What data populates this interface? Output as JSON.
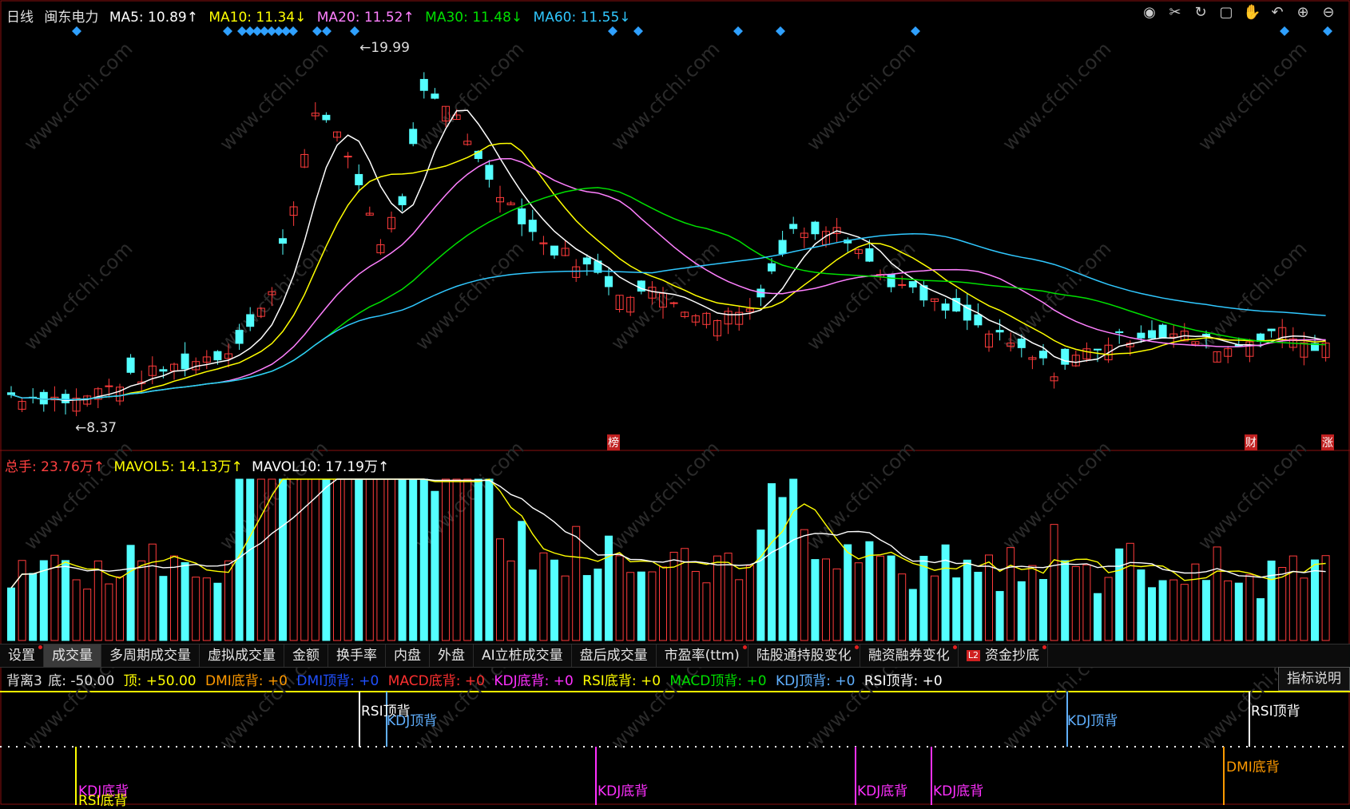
{
  "header": {
    "period": "日线",
    "stock_name": "闽东电力",
    "ma5": "MA5: 10.89↑",
    "ma10": "MA10: 11.34↓",
    "ma20": "MA20: 11.52↑",
    "ma30": "MA30: 11.48↓",
    "ma60": "MA60: 11.55↓"
  },
  "toolbar_icons": [
    "eye-icon",
    "scissors-icon",
    "refresh-icon",
    "lock-icon",
    "hand-icon",
    "undo-icon",
    "zoom-in-icon",
    "zoom-out-icon"
  ],
  "price_labels": {
    "high": "19.99",
    "low": "8.37"
  },
  "event_markers": [
    "榜",
    "财",
    "涨"
  ],
  "volume_header": {
    "total": "总手: 23.76万↑",
    "mavol5": "MAVOL5: 14.13万↑",
    "mavol10": "MAVOL10: 17.19万↑"
  },
  "tabs": [
    "设置",
    "成交量",
    "多周期成交量",
    "虚拟成交量",
    "金额",
    "换手率",
    "内盘",
    "外盘",
    "AI立桩成交量",
    "盘后成交量",
    "市盈率(ttm)",
    "陆股通持股变化",
    "融资融券变化",
    "资金抄底"
  ],
  "active_tab": "成交量",
  "l2_badge": "L2",
  "indicator_line": {
    "name": "背离3",
    "bottom": "底: -50.00",
    "top": "顶: +50.00",
    "dmi_bottom": "DMI底背: +0",
    "dmi_top": "DMI顶背: +0",
    "macd_bottom": "MACD底背: +0",
    "kdj_bottom": "KDJ底背: +0",
    "rsi_bottom": "RSI底背: +0",
    "macd_top": "MACD顶背: +0",
    "kdj_top": "KDJ顶背: +0",
    "rsi_top": "RSI顶背: +0"
  },
  "explain_button": "指标说明",
  "signal_labels": {
    "rsi_top": "RSI顶背",
    "kdj_top": "KDJ顶背",
    "kdj_bottom": "KDJ底背",
    "rsi_bottom": "RSI底背",
    "dmi_bottom": "DMI底背"
  },
  "watermark": "www.cfchi.com",
  "colors": {
    "up": "#ff3b3b",
    "down": "#54ffff",
    "ma5": "#ffffff",
    "ma10": "#ffff00",
    "ma20": "#ff80ff",
    "ma30": "#00e000",
    "ma60": "#30c8ff",
    "marker": "#2fa0ff"
  }
}
